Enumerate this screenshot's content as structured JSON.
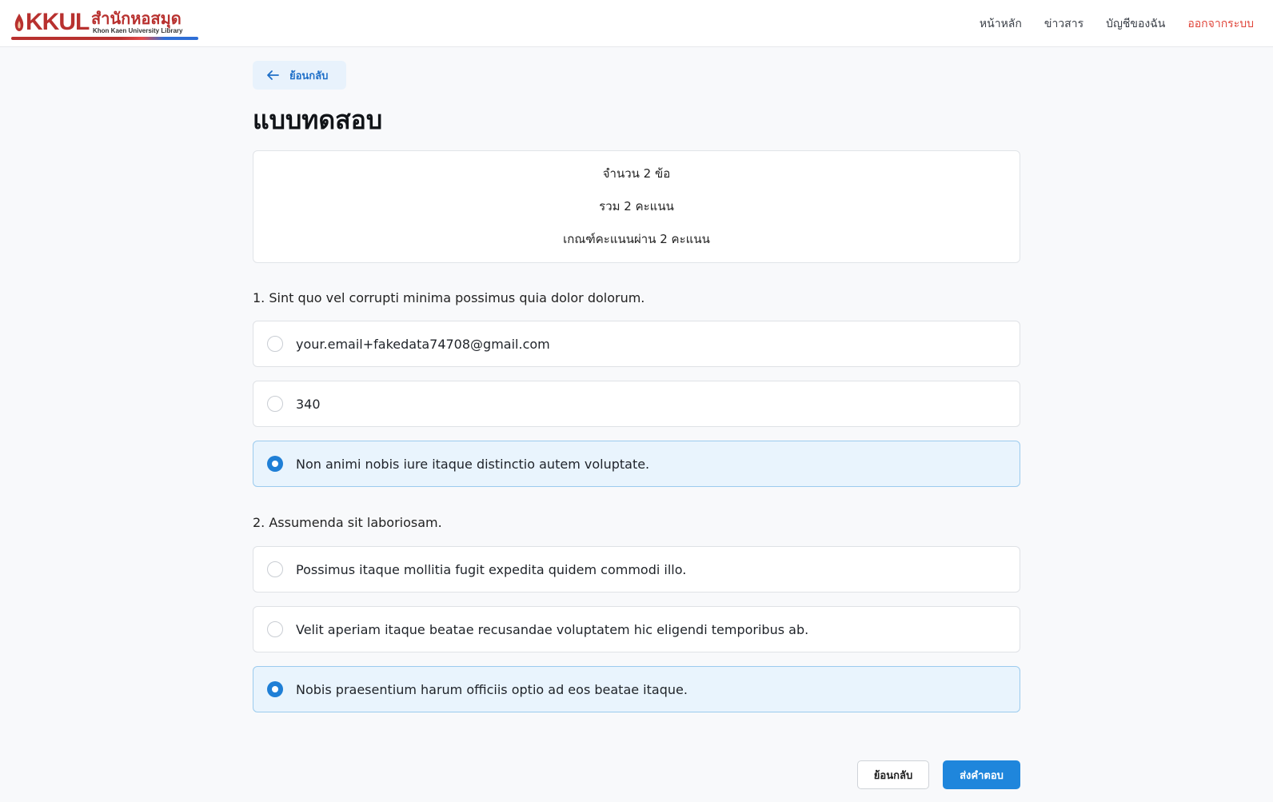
{
  "brand": {
    "short": "KKUL",
    "thai_name": "สำนักหอสมุด",
    "subtitle": "Khon Kaen University Library"
  },
  "nav": {
    "home": "หน้าหลัก",
    "news": "ข่าวสาร",
    "account": "บัญชีของฉัน",
    "logout": "ออกจากระบบ"
  },
  "back_link": {
    "label": "ย้อนกลับ",
    "icon": "arrow-left-icon"
  },
  "page_title": "แบบทดสอบ",
  "summary": {
    "question_count": "จำนวน 2 ข้อ",
    "total_score": "รวม 2 คะแนน",
    "pass_criteria": "เกณฑ์คะแนนผ่าน 2 คะแนน"
  },
  "questions": [
    {
      "title": "1. Sint quo vel corrupti minima possimus quia dolor dolorum.",
      "options": [
        {
          "label": "your.email+fakedata74708@gmail.com",
          "selected": false
        },
        {
          "label": "340",
          "selected": false
        },
        {
          "label": "Non animi nobis iure itaque distinctio autem voluptate.",
          "selected": true
        }
      ]
    },
    {
      "title": "2. Assumenda sit laboriosam.",
      "options": [
        {
          "label": "Possimus itaque mollitia fugit expedita quidem commodi illo.",
          "selected": false
        },
        {
          "label": "Velit aperiam itaque beatae recusandae voluptatem hic eligendi temporibus ab.",
          "selected": false
        },
        {
          "label": "Nobis praesentium harum officiis optio ad eos beatae itaque.",
          "selected": true
        }
      ]
    }
  ],
  "actions": {
    "back": "ย้อนกลับ",
    "submit": "ส่งคำตอบ"
  },
  "colors": {
    "brand_red": "#b8312f",
    "accent_blue": "#1f86dc",
    "selected_bg": "#e9f4fd",
    "logout_red": "#e0453a"
  }
}
